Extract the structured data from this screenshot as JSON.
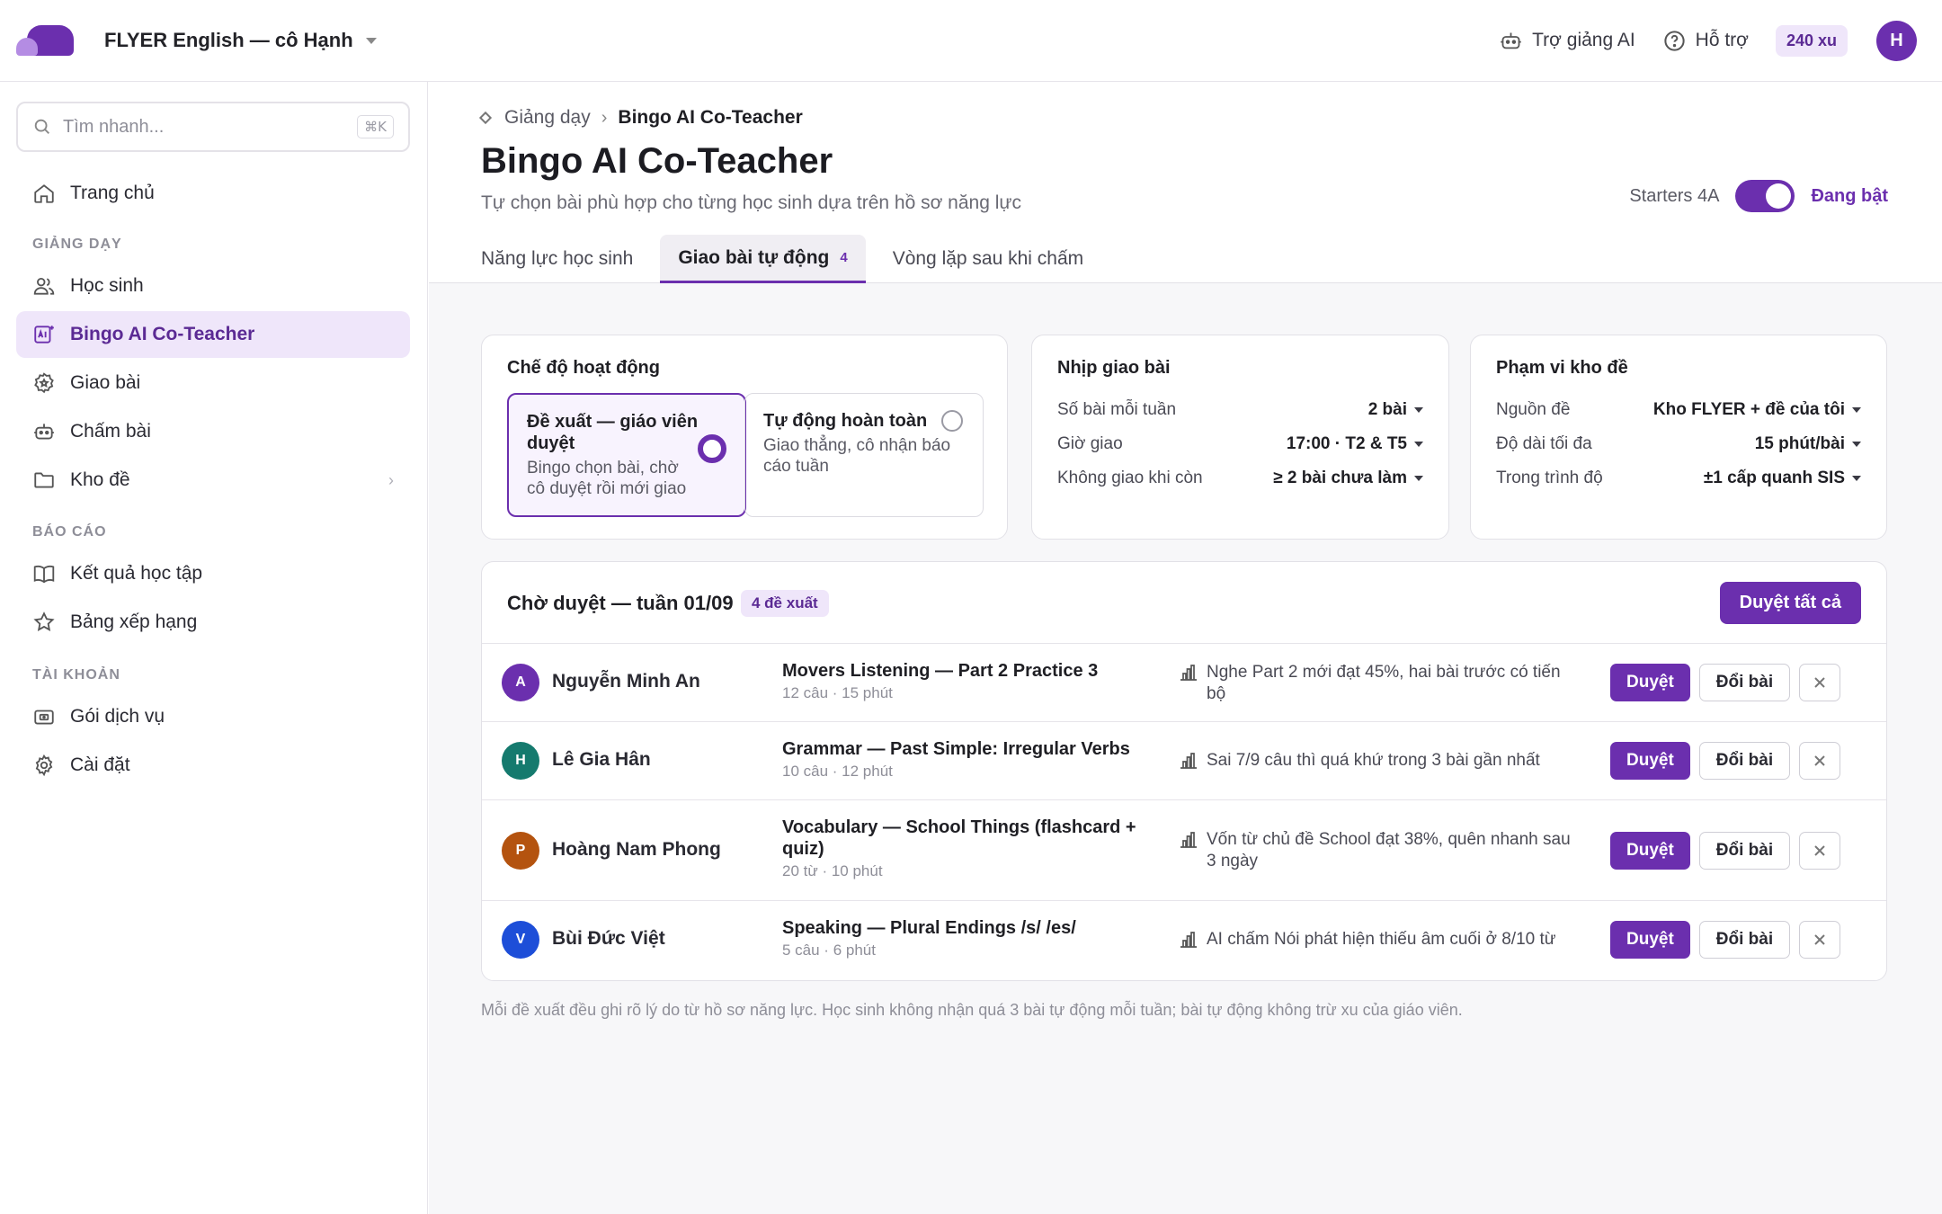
{
  "header": {
    "workspace": "FLYER English — cô Hạnh",
    "ai_assistant": "Trợ giảng AI",
    "support": "Hỗ trợ",
    "coins": "240 xu",
    "avatar_initial": "H"
  },
  "sidebar": {
    "search_placeholder": "Tìm nhanh...",
    "search_shortcut": "⌘K",
    "home": "Trang chủ",
    "section_teaching": "GIẢNG DẠY",
    "students": "Học sinh",
    "cot": "Bingo AI Co-Teacher",
    "assign": "Giao bài",
    "grade": "Chấm bài",
    "bank": "Kho đề",
    "section_reports": "BÁO CÁO",
    "results": "Kết quả học tập",
    "ranking": "Bảng xếp hạng",
    "section_account": "TÀI KHOẢN",
    "plans": "Gói dịch vụ",
    "settings": "Cài đặt"
  },
  "page": {
    "breadcrumb_parent": "Giảng dạy",
    "breadcrumb_current": "Bingo AI Co-Teacher",
    "title": "Bingo AI Co-Teacher",
    "subtitle": "Tự chọn bài phù hợp cho từng học sinh dựa trên hồ sơ năng lực",
    "class_name": "Starters 4A",
    "toggle_state": "Đang bật",
    "tabs": [
      {
        "label": "Năng lực học sinh"
      },
      {
        "label": "Giao bài tự động",
        "count": "4"
      },
      {
        "label": "Vòng lặp sau khi chấm"
      }
    ]
  },
  "mode": {
    "title": "Chế độ hoạt động",
    "opt1_title": "Đề xuất — giáo viên duyệt",
    "opt1_desc": "Bingo chọn bài, chờ cô duyệt rồi mới giao",
    "opt2_title": "Tự động hoàn toàn",
    "opt2_desc": "Giao thẳng, cô nhận báo cáo tuần"
  },
  "cadence": {
    "title": "Nhịp giao bài",
    "rows": [
      {
        "k": "Số bài mỗi tuần",
        "v": "2 bài"
      },
      {
        "k": "Giờ giao",
        "v": "17:00 · T2 & T5"
      },
      {
        "k": "Không giao khi còn",
        "v": "≥ 2 bài chưa làm"
      }
    ]
  },
  "scope": {
    "title": "Phạm vi kho đề",
    "rows": [
      {
        "k": "Nguồn đề",
        "v": "Kho FLYER + đề của tôi"
      },
      {
        "k": "Độ dài tối đa",
        "v": "15 phút/bài"
      },
      {
        "k": "Trong trình độ",
        "v": "±1 cấp quanh SIS"
      }
    ]
  },
  "pending": {
    "title": "Chờ duyệt — tuần 01/09",
    "badge": "4 đề xuất",
    "approve_all": "Duyệt tất cả",
    "approve": "Duyệt",
    "swap": "Đổi bài",
    "rows": [
      {
        "initial": "A",
        "color": "#6b2fae",
        "name": "Nguyễn Minh An",
        "lesson": "Movers Listening — Part 2 Practice 3",
        "meta": "12 câu · 15 phút",
        "reason": "Nghe Part 2 mới đạt 45%, hai bài trước có tiến bộ"
      },
      {
        "initial": "H",
        "color": "#157a6e",
        "name": "Lê Gia Hân",
        "lesson": "Grammar — Past Simple: Irregular Verbs",
        "meta": "10 câu · 12 phút",
        "reason": "Sai 7/9 câu thì quá khứ trong 3 bài gần nhất"
      },
      {
        "initial": "P",
        "color": "#b4530f",
        "name": "Hoàng Nam Phong",
        "lesson": "Vocabulary — School Things (flashcard + quiz)",
        "meta": "20 từ · 10 phút",
        "reason": "Vốn từ chủ đề School đạt 38%, quên nhanh sau 3 ngày"
      },
      {
        "initial": "V",
        "color": "#1d4ed8",
        "name": "Bùi Đức Việt",
        "lesson": "Speaking — Plural Endings /s/ /es/",
        "meta": "5 câu · 6 phút",
        "reason": "AI chấm Nói phát hiện thiếu âm cuối ở 8/10 từ"
      }
    ]
  },
  "footnote": "Mỗi đề xuất đều ghi rõ lý do từ hồ sơ năng lực. Học sinh không nhận quá 3 bài tự động mỗi tuần; bài tự động không trừ xu của giáo viên."
}
